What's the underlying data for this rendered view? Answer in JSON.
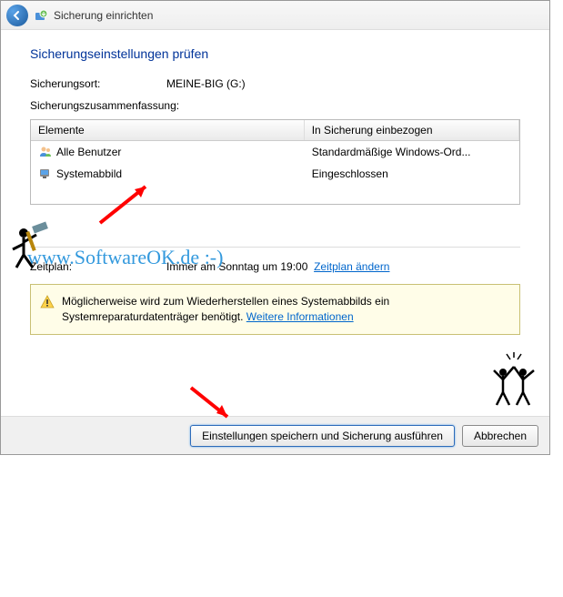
{
  "titlebar": {
    "title": "Sicherung einrichten"
  },
  "heading": "Sicherungseinstellungen prüfen",
  "location": {
    "label": "Sicherungsort:",
    "value": "MEINE-BIG (G:)"
  },
  "summary": {
    "label": "Sicherungszusammenfassung:",
    "columns": {
      "c1": "Elemente",
      "c2": "In Sicherung einbezogen"
    },
    "rows": [
      {
        "name": "Alle Benutzer",
        "included": "Standardmäßige Windows-Ord..."
      },
      {
        "name": "Systemabbild",
        "included": "Eingeschlossen"
      }
    ]
  },
  "schedule": {
    "label": "Zeitplan:",
    "value": "Immer am Sonntag um 19:00",
    "change_link": "Zeitplan ändern"
  },
  "warning": {
    "text": "Möglicherweise wird zum Wiederherstellen eines Systemabbilds ein Systemreparaturdatenträger benötigt. ",
    "more_link": "Weitere Informationen"
  },
  "footer": {
    "primary": "Einstellungen speichern und Sicherung ausführen",
    "cancel": "Abbrechen"
  },
  "watermark": "www.SoftwareOK.de :-)"
}
